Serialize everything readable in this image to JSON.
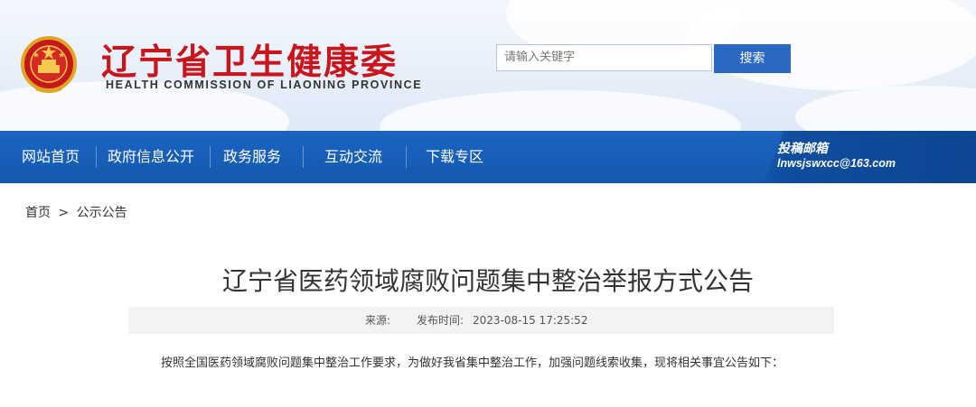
{
  "header": {
    "title_cn": "辽宁省卫生健康委",
    "title_en": "HEALTH COMMISSION OF LIAONING PROVINCE",
    "emblem_icon": "national-emblem-icon"
  },
  "search": {
    "placeholder": "请输入关键字",
    "button_label": "搜索"
  },
  "nav": {
    "items": [
      {
        "label": "网站首页"
      },
      {
        "label": "政府信息公开"
      },
      {
        "label": "政务服务"
      },
      {
        "label": "互动交流"
      },
      {
        "label": "下载专区"
      }
    ],
    "mail_title": "投稿邮箱",
    "mail_address": "lnwsjswxcc@163.com"
  },
  "breadcrumb": {
    "home": "首页",
    "separator": ">",
    "current": "公示公告"
  },
  "article": {
    "title": "辽宁省医药领域腐败问题集中整治举报方式公告",
    "source_label": "来源:",
    "date_label": "发布时间:",
    "date_value": "2023-08-15 17:25:52",
    "body": "按照全国医药领域腐败问题集中整治工作要求，为做好我省集中整治工作，加强问题线索收集，现将相关事宜公告如下："
  },
  "colors": {
    "brand_red": "#c8161d",
    "nav_blue": "#1a64c0",
    "button_blue": "#2c69c4"
  }
}
